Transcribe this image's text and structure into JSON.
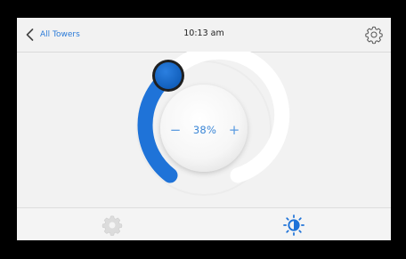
{
  "header": {
    "back_label": "All Towers",
    "time": "10:13 am",
    "settings_icon": "gear-icon"
  },
  "dial": {
    "value_label": "38%",
    "level_percent": 38,
    "decrease_label": "−",
    "increase_label": "+",
    "colors": {
      "active_arc": "#1f73d8",
      "track": "#ffffff",
      "knob": "#1766c9"
    }
  },
  "footer": {
    "tabs": [
      {
        "icon": "fan-gear-icon",
        "active": false,
        "color": "#d9d9d9"
      },
      {
        "icon": "brightness-icon",
        "active": true,
        "color": "#1f73d8"
      }
    ]
  }
}
